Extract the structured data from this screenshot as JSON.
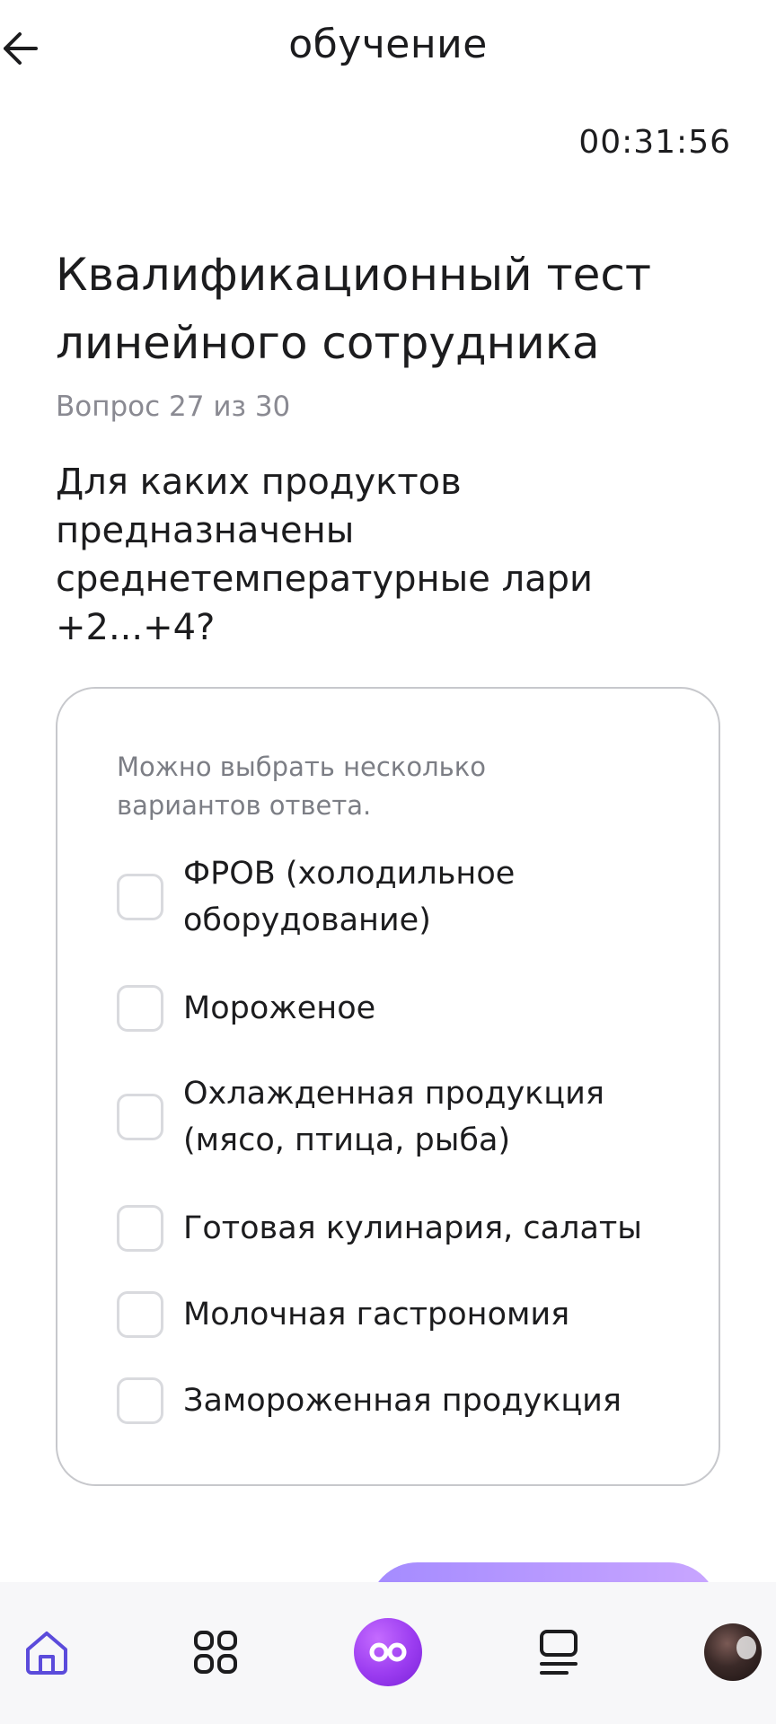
{
  "header": {
    "title": "обучение",
    "back_icon": "arrow-left-icon"
  },
  "timer": "00:31:56",
  "test": {
    "title": "Квалификационный тест линейного сотрудника",
    "progress": "Вопрос 27 из 30",
    "question": "Для каких продуктов предназначены среднетемпературные лари +2...+4?"
  },
  "answers": {
    "hint": "Можно выбрать несколько вариантов ответа.",
    "options": [
      {
        "label": "ФРОВ (холодильное оборудование)",
        "checked": false
      },
      {
        "label": "Мороженое",
        "checked": false
      },
      {
        "label": "Охлажденная продукция (мясо, птица, рыба)",
        "checked": false
      },
      {
        "label": "Готовая кулинария, салаты",
        "checked": false
      },
      {
        "label": "Молочная гастрономия",
        "checked": false
      },
      {
        "label": "Замороженная продукция",
        "checked": false
      }
    ]
  },
  "colors": {
    "accent": "#6a4cff",
    "nav_home": "#5b4bdb",
    "text": "#1c1c1e",
    "muted": "#8a8a92"
  },
  "bottom_nav": {
    "items": [
      {
        "icon": "home-icon",
        "active": true
      },
      {
        "icon": "grid-icon",
        "active": false
      },
      {
        "icon": "infinity-orb-icon",
        "active": false
      },
      {
        "icon": "list-icon",
        "active": false
      },
      {
        "icon": "avatar",
        "active": false
      }
    ]
  }
}
